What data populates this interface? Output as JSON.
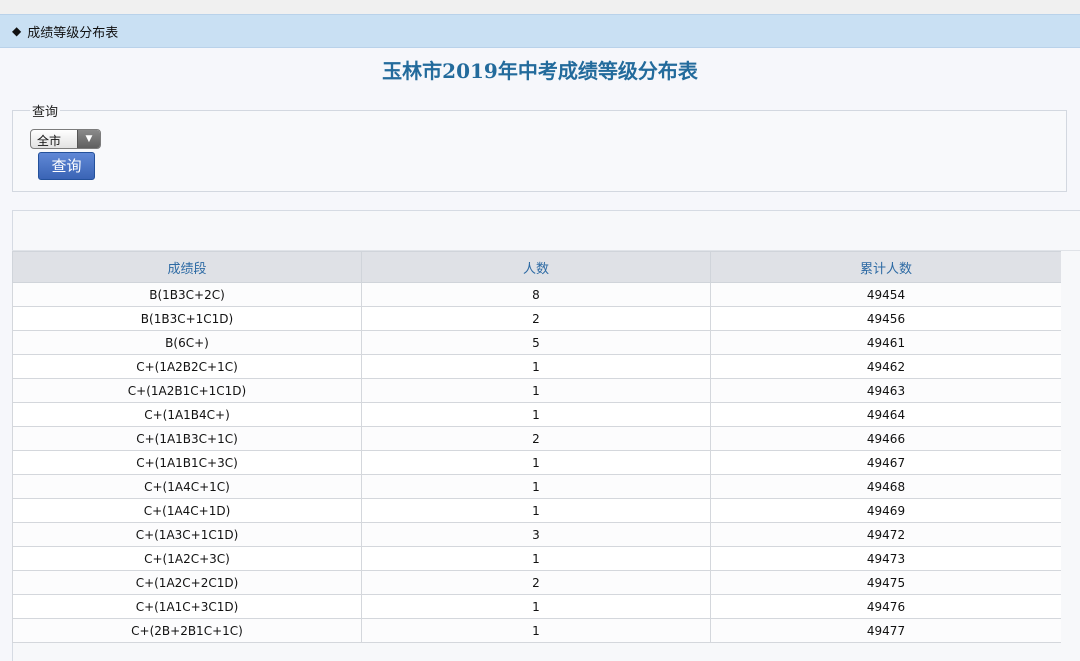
{
  "header": {
    "label": "成绩等级分布表",
    "marker": "◆"
  },
  "page_title": "玉林市2019年中考成绩等级分布表",
  "query": {
    "legend": "查询",
    "region_select": {
      "selected": "全市"
    },
    "button_label": "查询"
  },
  "table": {
    "columns": [
      "成绩段",
      "人数",
      "累计人数"
    ],
    "rows": [
      [
        "B(1B3C+2C)",
        "8",
        "49454"
      ],
      [
        "B(1B3C+1C1D)",
        "2",
        "49456"
      ],
      [
        "B(6C+)",
        "5",
        "49461"
      ],
      [
        "C+(1A2B2C+1C)",
        "1",
        "49462"
      ],
      [
        "C+(1A2B1C+1C1D)",
        "1",
        "49463"
      ],
      [
        "C+(1A1B4C+)",
        "1",
        "49464"
      ],
      [
        "C+(1A1B3C+1C)",
        "2",
        "49466"
      ],
      [
        "C+(1A1B1C+3C)",
        "1",
        "49467"
      ],
      [
        "C+(1A4C+1C)",
        "1",
        "49468"
      ],
      [
        "C+(1A4C+1D)",
        "1",
        "49469"
      ],
      [
        "C+(1A3C+1C1D)",
        "3",
        "49472"
      ],
      [
        "C+(1A2C+3C)",
        "1",
        "49473"
      ],
      [
        "C+(1A2C+2C1D)",
        "2",
        "49475"
      ],
      [
        "C+(1A1C+3C1D)",
        "1",
        "49476"
      ],
      [
        "C+(2B+2B1C+1C)",
        "1",
        "49477"
      ]
    ]
  },
  "colors": {
    "header_bar": "#c9e0f3",
    "title": "#236b9c",
    "button": "#3f69b8",
    "table_header_text": "#2d6aa4"
  }
}
